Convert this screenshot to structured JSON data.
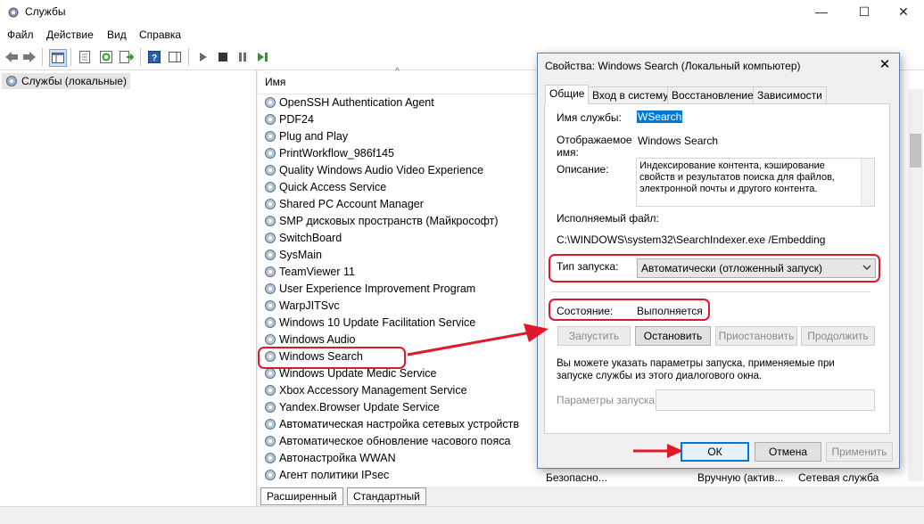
{
  "window": {
    "title": "Службы",
    "minimize": "—",
    "maximize": "☐",
    "close": "✕"
  },
  "menu": [
    "Файл",
    "Действие",
    "Вид",
    "Справка"
  ],
  "tree": {
    "root": "Службы (локальные)"
  },
  "list": {
    "column_name": "Имя",
    "services": [
      "OpenSSH Authentication Agent",
      "PDF24",
      "Plug and Play",
      "PrintWorkflow_986f145",
      "Quality Windows Audio Video Experience",
      "Quick Access Service",
      "Shared PC Account Manager",
      "SMP дисковых пространств (Майкрософт)",
      "SwitchBoard",
      "SysMain",
      "TeamViewer 11",
      "User Experience Improvement Program",
      "WarpJITSvc",
      "Windows 10 Update Facilitation Service",
      "Windows Audio",
      "Windows Search",
      "Windows Update Medic Service",
      "Xbox Accessory Management Service",
      "Yandex.Browser Update Service",
      "Автоматическая настройка сетевых устройств",
      "Автоматическое обновление часового пояса",
      "Автонастройка WWAN",
      "Агент политики IPsec"
    ],
    "last_row_extra": {
      "description": "Безопасно...",
      "startup": "Вручную (актив...",
      "logon": "Сетевая служба"
    }
  },
  "bottom_tabs": [
    "Расширенный",
    "Стандартный"
  ],
  "dialog": {
    "title": "Свойства: Windows Search (Локальный компьютер)",
    "close": "✕",
    "tabs": [
      "Общие",
      "Вход в систему",
      "Восстановление",
      "Зависимости"
    ],
    "service_name_label": "Имя службы:",
    "service_name_value": "WSearch",
    "display_name_label_1": "Отображаемое",
    "display_name_label_2": "имя:",
    "display_name_value": "Windows Search",
    "description_label": "Описание:",
    "description_value": "Индексирование контента, кэширование свойств и результатов поиска для файлов, электронной почты и другого контента.",
    "exe_label": "Исполняемый файл:",
    "exe_value": "C:\\WINDOWS\\system32\\SearchIndexer.exe /Embedding",
    "startup_label": "Тип запуска:",
    "startup_value": "Автоматически (отложенный запуск)",
    "state_label": "Состояние:",
    "state_value": "Выполняется",
    "btn_start": "Запустить",
    "btn_stop": "Остановить",
    "btn_pause": "Приостановить",
    "btn_resume": "Продолжить",
    "hint": "Вы можете указать параметры запуска, применяемые при запуске службы из этого диалогового окна.",
    "params_label": "Параметры запуска:",
    "params_value": "",
    "btn_ok": "ОК",
    "btn_cancel": "Отмена",
    "btn_apply": "Применить"
  },
  "colors": {
    "highlight": "#e0192a",
    "selection": "#0078d7",
    "dialog_border": "#5a7fb7"
  }
}
